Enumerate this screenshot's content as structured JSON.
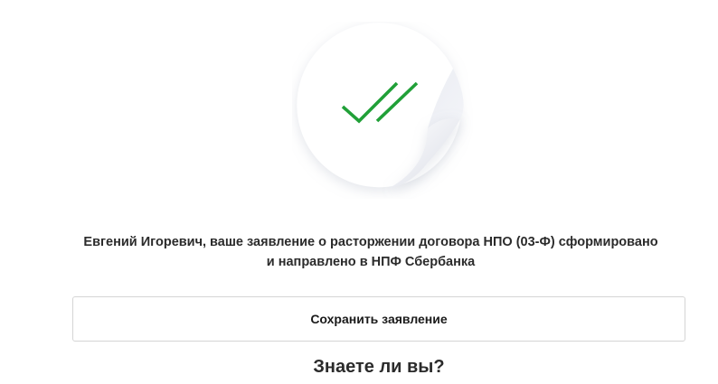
{
  "status": {
    "icon": "double-check-icon",
    "accent_color": "#21a038"
  },
  "message": {
    "line1": "Евгений Игоревич, ваше заявление о расторжении договора НПО (03-Ф) сформировано",
    "line2": "и направлено в НПФ Сбербанка"
  },
  "actions": {
    "save_label": "Сохранить заявление"
  },
  "info": {
    "heading": "Знаете ли вы?"
  }
}
